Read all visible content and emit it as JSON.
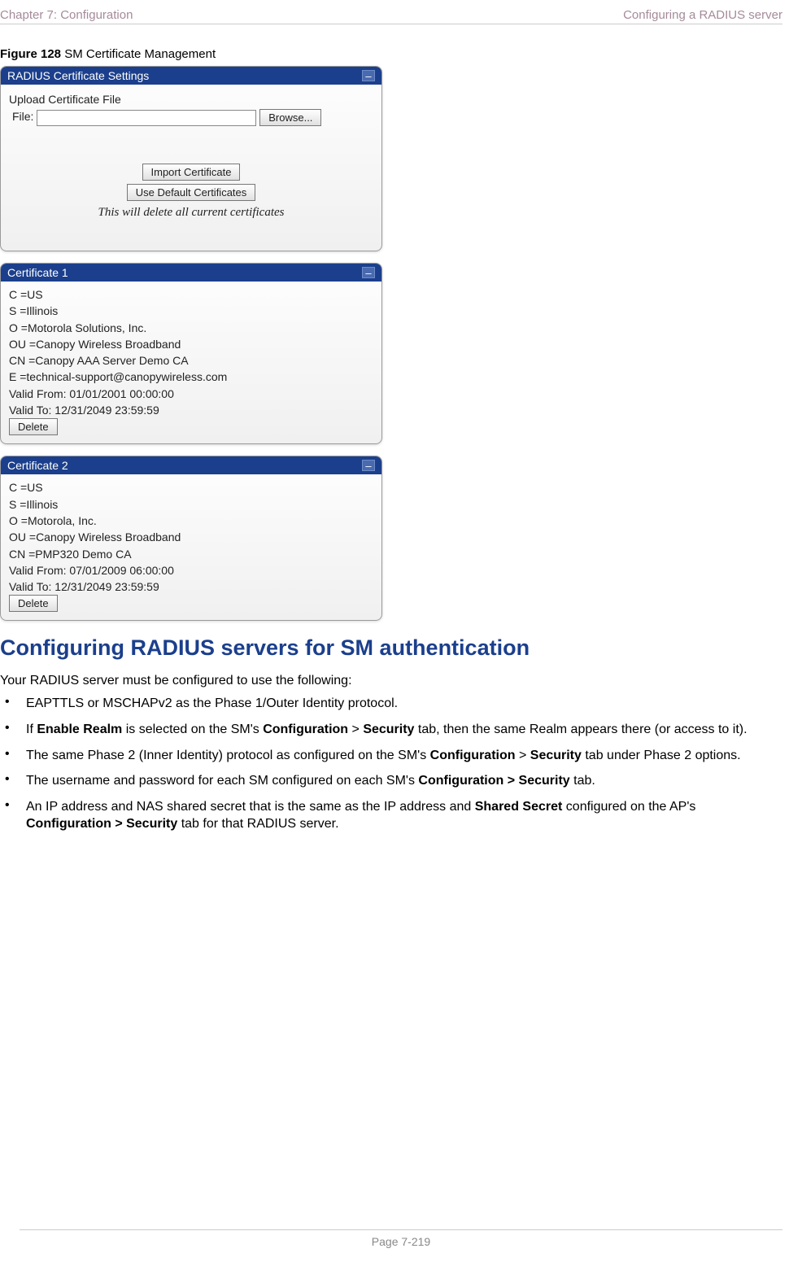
{
  "header": {
    "left": "Chapter 7:  Configuration",
    "right": "Configuring a RADIUS server"
  },
  "figure": {
    "label_bold": "Figure 128",
    "label_rest": " SM Certificate Management"
  },
  "panels": {
    "radius": {
      "title": "RADIUS Certificate Settings",
      "upload_label": "Upload Certificate File",
      "file_label": "File:",
      "browse": "Browse...",
      "import": "Import Certificate",
      "use_default": "Use Default Certificates",
      "note": "This will delete all current certificates"
    },
    "cert1": {
      "title": "Certificate 1",
      "lines": [
        "C =US",
        "S =Illinois",
        "O =Motorola Solutions, Inc.",
        "OU =Canopy Wireless Broadband",
        "CN =Canopy AAA Server Demo CA",
        "E =technical-support@canopywireless.com",
        "Valid From: 01/01/2001 00:00:00",
        "Valid To: 12/31/2049 23:59:59"
      ],
      "delete": "Delete"
    },
    "cert2": {
      "title": "Certificate 2",
      "lines": [
        "C =US",
        "S =Illinois",
        "O =Motorola, Inc.",
        "OU =Canopy Wireless Broadband",
        "CN =PMP320 Demo CA",
        "Valid From: 07/01/2009 06:00:00",
        "Valid To: 12/31/2049 23:59:59"
      ],
      "delete": "Delete"
    }
  },
  "heading2": "Configuring RADIUS servers for SM authentication",
  "intro": "Your RADIUS server must be configured to use the following:",
  "bullets": {
    "b1": "EAPTTLS or MSCHAPv2 as the Phase 1/Outer Identity protocol.",
    "b2_a": "If ",
    "b2_b": "Enable Realm",
    "b2_c": " is selected on the SM's ",
    "b2_d": "Configuration",
    "b2_e": " > ",
    "b2_f": "Security",
    "b2_g": " tab, then the same Realm appears there (or access to it).",
    "b3_a": "The same Phase 2 (Inner Identity) protocol as configured on the SM's ",
    "b3_b": "Configuration",
    "b3_c": " > ",
    "b3_d": "Security",
    "b3_e": " tab under Phase 2 options.",
    "b4_a": "The username and password for each SM configured on each SM's ",
    "b4_b": "Configuration > Security",
    "b4_c": " tab.",
    "b5_a": "An IP address and NAS shared secret that is the same as the IP address and ",
    "b5_b": "Shared Secret",
    "b5_c": " configured on the AP's ",
    "b5_d": "Configuration > Security",
    "b5_e": " tab for that RADIUS server."
  },
  "footer": "Page 7-219"
}
